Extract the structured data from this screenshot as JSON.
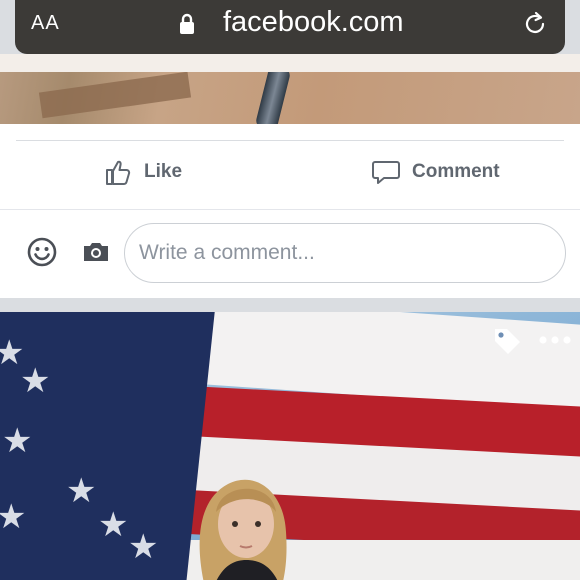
{
  "browser": {
    "text_size_label": "AA",
    "domain": "facebook.com"
  },
  "post_actions": {
    "like_label": "Like",
    "comment_label": "Comment"
  },
  "comment_box": {
    "placeholder": "Write a comment..."
  },
  "icons": {
    "lock": "lock-icon",
    "reload": "reload-icon",
    "like": "thumbs-up-icon",
    "comment": "speech-bubble-icon",
    "emoji": "smiley-icon",
    "camera": "camera-icon",
    "tag": "tag-icon",
    "more": "more-dots-icon"
  },
  "colors": {
    "url_bar": "#3c3a37",
    "action_text": "#606770",
    "placeholder": "#8d949e"
  }
}
